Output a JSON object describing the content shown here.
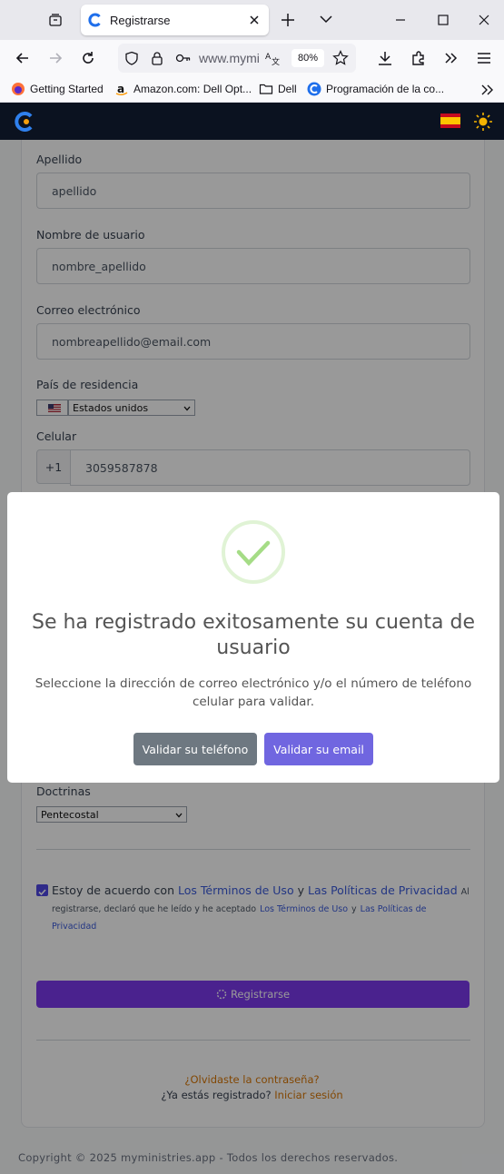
{
  "browser": {
    "tab_title": "Registrarse",
    "url_text": "www.mymi",
    "zoom": "80%",
    "bookmarks": [
      {
        "label": "Getting Started",
        "icon": "firefox-icon"
      },
      {
        "label": "Amazon.com: Dell Opt...",
        "icon": "amazon-icon"
      },
      {
        "label": "Dell",
        "icon": "folder-icon"
      },
      {
        "label": "Programación de la co...",
        "icon": "site-c-icon"
      }
    ]
  },
  "form": {
    "apellido_label": "Apellido",
    "apellido_value": "apellido",
    "usuario_label": "Nombre de usuario",
    "usuario_value": "nombre_apellido",
    "correo_label": "Correo electrónico",
    "correo_value": "nombreapellido@email.com",
    "pais_label": "País de residencia",
    "pais_value": "Estados unidos",
    "celular_label": "Celular",
    "celular_prefix": "+1",
    "celular_value": "3059587878",
    "doctrinas_label": "Doctrinas",
    "doctrinas_value": "Pentecostal",
    "terms_text_1": "Estoy de acuerdo con",
    "terms_link_1": "Los Términos de Uso",
    "terms_and": "y",
    "terms_link_2": "Las Políticas de Privacidad",
    "terms_small_1": "Al registrarse, declaró que he leído y he aceptado",
    "terms_small_link_1": "Los Términos de Uso",
    "terms_small_and": "y",
    "terms_small_link_2": "Las Políticas de Privacidad",
    "submit_label": "Registrarse",
    "forgot_label": "¿Olvidaste la contraseña?",
    "registered_label": "¿Ya estás registrado?",
    "login_label": "Iniciar sesión"
  },
  "footer": "Copyright © 2025 myministries.app - Todos los derechos reservados.",
  "modal": {
    "title": "Se ha registrado exitosamente su cuenta de usuario",
    "text": "Seleccione la dirección de correo electrónico y/o el número de teléfono celular para validar.",
    "phone_button": "Validar su teléfono",
    "email_button": "Validar su email"
  },
  "colors": {
    "appbar": "#0b1220",
    "primary": "#7066e0",
    "secondary": "#6e7881",
    "success": "#a5dc86",
    "link": "#3b5bdb",
    "orange": "#f59e0b"
  }
}
